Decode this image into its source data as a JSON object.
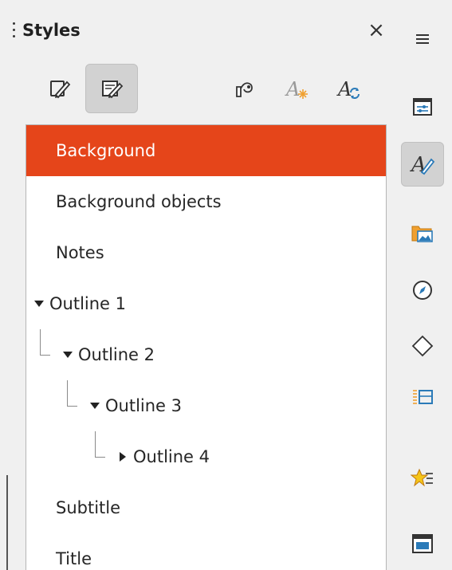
{
  "panel": {
    "title": "Styles",
    "close_glyph": "×"
  },
  "toolbar": {
    "buttons": [
      {
        "name": "drawing-styles-icon",
        "active": false
      },
      {
        "name": "presentation-styles-icon",
        "active": true
      },
      {
        "name": "fill-format-mode-icon",
        "active": false
      },
      {
        "name": "new-style-from-selection-icon",
        "active": false
      },
      {
        "name": "update-style-icon",
        "active": false
      }
    ]
  },
  "styles_list": {
    "items": [
      {
        "label": "Background",
        "selected": true
      },
      {
        "label": "Background objects",
        "selected": false
      },
      {
        "label": "Notes",
        "selected": false
      },
      {
        "label": "Outline 1",
        "expanded": true
      },
      {
        "label": "Outline 2",
        "expanded": true
      },
      {
        "label": "Outline 3",
        "expanded": true
      },
      {
        "label": "Outline 4",
        "expanded": false
      },
      {
        "label": "Subtitle",
        "selected": false
      },
      {
        "label": "Title",
        "selected": false
      }
    ]
  },
  "sidebar": {
    "menu_icon": "hamburger-menu-icon",
    "decks": [
      {
        "name": "properties-icon",
        "active": false
      },
      {
        "name": "styles-icon",
        "active": true
      },
      {
        "name": "gallery-icon",
        "active": false
      },
      {
        "name": "navigator-icon",
        "active": false
      },
      {
        "name": "shapes-icon",
        "active": false
      },
      {
        "name": "slide-layouts-icon",
        "active": false
      },
      {
        "name": "animation-icon",
        "active": false
      },
      {
        "name": "master-slides-icon",
        "active": false
      }
    ]
  },
  "colors": {
    "selection": "#e5451a",
    "background": "#f0f0f0",
    "list_background": "#ffffff"
  }
}
